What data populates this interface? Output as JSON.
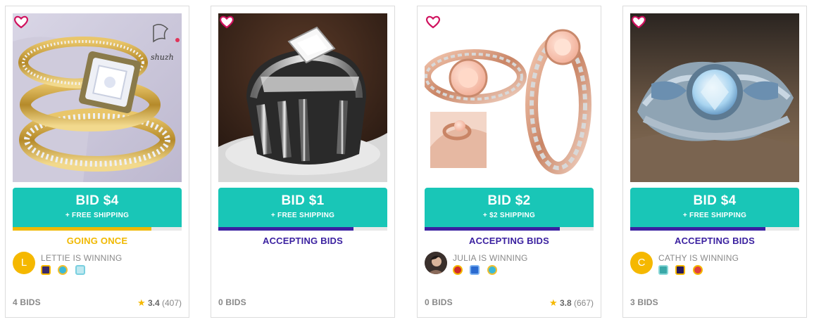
{
  "colors": {
    "accent": "#19c6b7",
    "accepting": "#3b21a0",
    "going": "#f0b800"
  },
  "cards": [
    {
      "image": "gold-diamond-ring-set",
      "watermark": "shuzh",
      "favorite_icon": "heart-outline-icon",
      "bid_label": "BID $4",
      "shipping_label": "+ FREE SHIPPING",
      "progress": 0.82,
      "progress_color": "#f0b800",
      "status": "GOING ONCE",
      "status_color": "#f0b800",
      "winner": {
        "name": "LETTIE",
        "suffix": "IS WINNING",
        "initial": "L",
        "avatar_color": "#f5b800",
        "badges": [
          "badge-crown",
          "badge-flower",
          "badge-gift"
        ]
      },
      "bids": "4 BIDS",
      "rating": {
        "score": "3.4",
        "count": "(407)"
      }
    },
    {
      "image": "silver-princess-cut-ring",
      "favorite_icon": "heart-outline-icon",
      "bid_label": "BID $1",
      "shipping_label": "+ FREE SHIPPING",
      "progress": 0.8,
      "progress_color": "#3b21a0",
      "status": "ACCEPTING BIDS",
      "status_color": "#3b21a0",
      "bids": "0 BIDS"
    },
    {
      "image": "rose-gold-morganite-ring",
      "favorite_icon": "heart-outline-icon",
      "bid_label": "BID $2",
      "shipping_label": "+ $2 SHIPPING",
      "progress": 0.8,
      "progress_color": "#3b21a0",
      "status": "ACCEPTING BIDS",
      "status_color": "#3b21a0",
      "winner": {
        "name": "JULIA",
        "suffix": "IS WINNING",
        "initial": "",
        "avatar_color": "#5a4a46",
        "badges": [
          "badge-ladybug",
          "badge-bus",
          "badge-flower"
        ]
      },
      "bids": "0 BIDS",
      "rating": {
        "score": "3.8",
        "count": "(667)"
      }
    },
    {
      "image": "vintage-sapphire-ring",
      "favorite_icon": "heart-outline-icon",
      "bid_label": "BID $4",
      "shipping_label": "+ FREE SHIPPING",
      "progress": 0.8,
      "progress_color": "#3b21a0",
      "status": "ACCEPTING BIDS",
      "status_color": "#3b21a0",
      "winner": {
        "name": "CATHY",
        "suffix": "IS WINNING",
        "initial": "C",
        "avatar_color": "#f5b800",
        "badges": [
          "badge-robot",
          "badge-cat",
          "badge-ring"
        ]
      },
      "bids": "3 BIDS"
    }
  ]
}
